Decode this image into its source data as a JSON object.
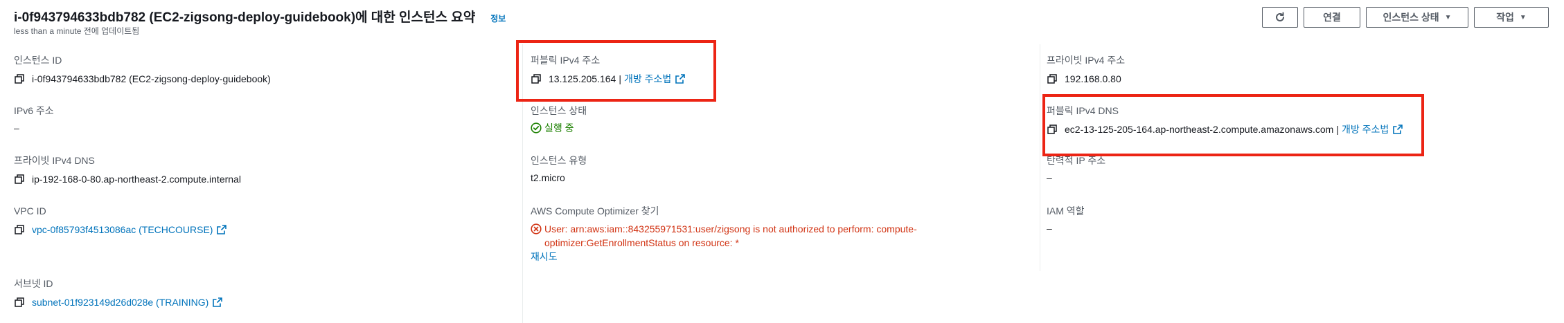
{
  "header": {
    "title": "i-0f943794633bdb782 (EC2-zigsong-deploy-guidebook)에 대한 인스턴스 요약",
    "info_label": "정보",
    "updated": "less than a minute 전에 업데이트됨",
    "buttons": {
      "connect": "연결",
      "instance_state": "인스턴스 상태",
      "actions": "작업"
    }
  },
  "fields": {
    "instance_id": {
      "label": "인스턴스 ID",
      "value": "i-0f943794633bdb782 (EC2-zigsong-deploy-guidebook)"
    },
    "public_ipv4": {
      "label": "퍼블릭 IPv4 주소",
      "value": "13.125.205.164",
      "sep": "|",
      "link": "개방 주소법"
    },
    "private_ipv4": {
      "label": "프라이빗 IPv4 주소",
      "value": "192.168.0.80"
    },
    "ipv6": {
      "label": "IPv6 주소",
      "value": "–"
    },
    "instance_state": {
      "label": "인스턴스 상태",
      "value": "실행 중"
    },
    "public_dns": {
      "label": "퍼블릭 IPv4 DNS",
      "value": "ec2-13-125-205-164.ap-northeast-2.compute.amazonaws.com",
      "sep": "|",
      "link": "개방 주소법"
    },
    "private_dns": {
      "label": "프라이빗 IPv4 DNS",
      "value": "ip-192-168-0-80.ap-northeast-2.compute.internal"
    },
    "instance_type": {
      "label": "인스턴스 유형",
      "value": "t2.micro"
    },
    "elastic_ip": {
      "label": "탄력적 IP 주소",
      "value": "–"
    },
    "vpc_id": {
      "label": "VPC ID",
      "value": "vpc-0f85793f4513086ac (TECHCOURSE)"
    },
    "compute_optimizer": {
      "label": "AWS Compute Optimizer 찾기",
      "error": "User: arn:aws:iam::843255971531:user/zigsong is not authorized to perform: compute-optimizer:GetEnrollmentStatus on resource: *",
      "retry": "재시도"
    },
    "iam_role": {
      "label": "IAM 역할",
      "value": "–"
    },
    "subnet_id": {
      "label": "서브넷 ID",
      "value": "subnet-01f923149d26d028e (TRAINING)"
    }
  },
  "colors": {
    "link": "#0073bb",
    "success": "#1d8102",
    "error": "#d13212",
    "highlight": "#ec2414"
  }
}
